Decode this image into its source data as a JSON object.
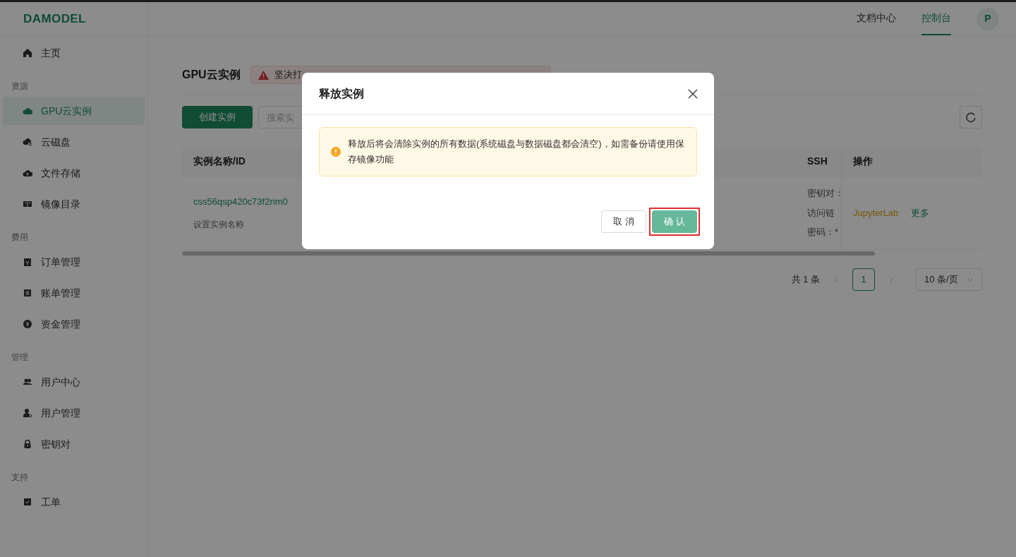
{
  "logo": "DAMODEL",
  "top_nav": [
    {
      "label": "文档中心",
      "selected": false
    },
    {
      "label": "控制台",
      "selected": true
    }
  ],
  "avatar": "P",
  "sidebar": [
    {
      "items": [
        {
          "label": "主页",
          "selected": false
        }
      ]
    },
    {
      "title": "资源",
      "items": [
        {
          "label": "GPU云实例",
          "selected": true
        },
        {
          "label": "云磁盘",
          "selected": false
        },
        {
          "label": "文件存储",
          "selected": false
        },
        {
          "label": "镜像目录",
          "selected": false
        }
      ]
    },
    {
      "title": "费用",
      "items": [
        {
          "label": "订单管理",
          "selected": false
        },
        {
          "label": "账单管理",
          "selected": false
        },
        {
          "label": "资金管理",
          "selected": false
        }
      ]
    },
    {
      "title": "管理",
      "items": [
        {
          "label": "用户中心",
          "selected": false
        },
        {
          "label": "用户管理",
          "selected": false
        },
        {
          "label": "密钥对",
          "selected": false
        }
      ]
    },
    {
      "title": "支持",
      "items": [
        {
          "label": "工单",
          "selected": false
        }
      ]
    }
  ],
  "page_title": "GPU云实例",
  "notice": "坚决打",
  "create_button": "创建实例",
  "search": {
    "placeholder": "搜索实"
  },
  "table": {
    "columns": [
      "实例名称/ID",
      "SSH",
      "操作"
    ],
    "rows": [
      {
        "id": "css56qsp420c73f2rim0",
        "name_link": "设置实例名称",
        "ssh": [
          "密钥对：",
          "访问链",
          "密码：*"
        ],
        "actions": [
          "JupyterLab",
          "更多"
        ]
      }
    ]
  },
  "pagination": {
    "total": "共 1 条",
    "pages": [
      {
        "label": "1",
        "selected": true
      }
    ],
    "page_size": "10 条/页"
  },
  "dialog": {
    "title": "释放实例",
    "warning": "释放后将会清除实例的所有数据(系统磁盘与数据磁盘都会清空)，如需备份请使用保存镜像功能",
    "buttons": [
      {
        "label": "取 消",
        "kind": "secondary",
        "highlighted": false
      },
      {
        "label": "确 认",
        "kind": "primary",
        "highlighted": true
      }
    ]
  }
}
